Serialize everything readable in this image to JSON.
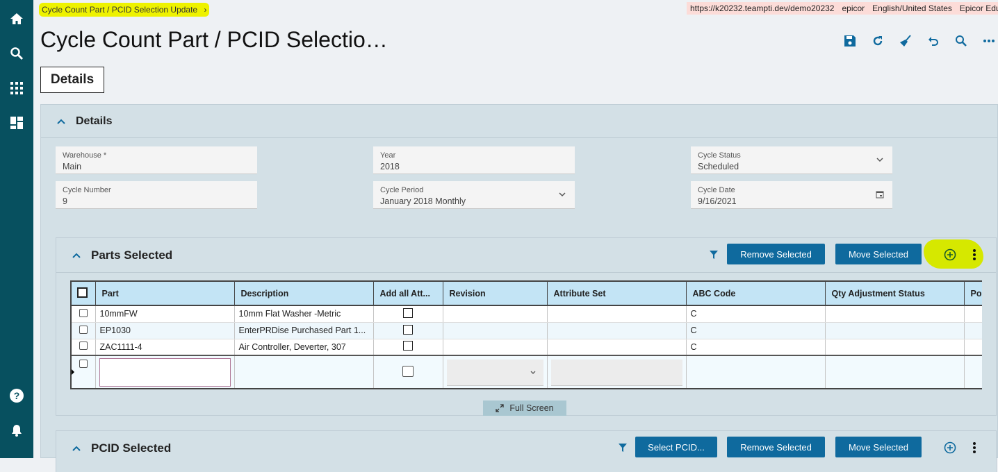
{
  "breadcrumb": {
    "label": "Cycle Count Part / PCID Selection Update",
    "chevron": "›"
  },
  "topbar": {
    "url": "https://k20232.teampti.dev/demo20232",
    "user": "epicor",
    "language": "English/United States",
    "company": "Epicor Education"
  },
  "page_title": "Cycle Count Part / PCID Selectio…",
  "tabs": [
    {
      "label": "Details"
    }
  ],
  "details": {
    "title": "Details",
    "fields": {
      "warehouse": {
        "label": "Warehouse *",
        "value": "Main"
      },
      "year": {
        "label": "Year",
        "value": "2018"
      },
      "cycle_status": {
        "label": "Cycle Status",
        "value": "Scheduled"
      },
      "cycle_number": {
        "label": "Cycle Number",
        "value": "9"
      },
      "cycle_period": {
        "label": "Cycle Period",
        "value": "January 2018 Monthly"
      },
      "cycle_date": {
        "label": "Cycle Date",
        "value": "9/16/2021"
      }
    }
  },
  "parts_selected": {
    "title": "Parts Selected",
    "remove_label": "Remove Selected",
    "move_label": "Move Selected",
    "columns": [
      "Part",
      "Description",
      "Add all Att...",
      "Revision",
      "Attribute Set",
      "ABC Code",
      "Qty Adjustment Status",
      "Pos"
    ],
    "rows": [
      {
        "part": "10mmFW",
        "description": "10mm Flat Washer -Metric",
        "abc": "C"
      },
      {
        "part": "EP1030",
        "description": "EnterPRDise Purchased Part 1...",
        "abc": "C"
      },
      {
        "part": "ZAC1111-4",
        "description": "Air Controller, Deverter, 307",
        "abc": "C"
      }
    ],
    "fullscreen_label": "Full Screen"
  },
  "pcid_selected": {
    "title": "PCID Selected",
    "select_label": "Select PCID...",
    "remove_label": "Remove Selected",
    "move_label": "Move Selected"
  },
  "colors": {
    "sidebar": "#07505f",
    "accent": "#0f6a9e",
    "highlight": "#eef200",
    "panel": "#d3e0e6",
    "grid_header": "#c3e4f5"
  }
}
